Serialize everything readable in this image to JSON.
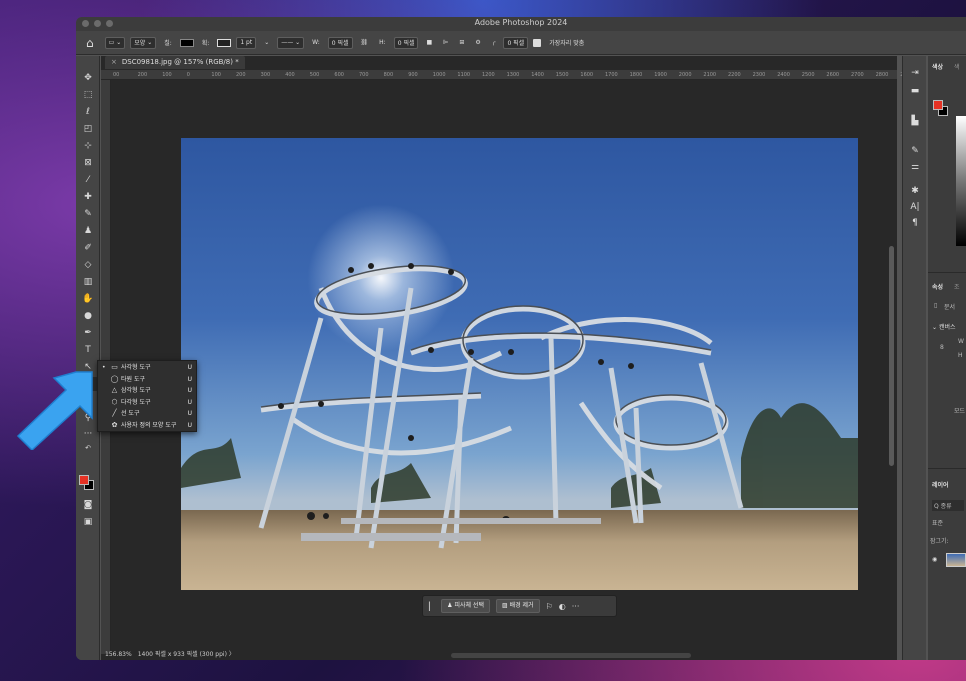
{
  "app_title": "Adobe Photoshop 2024",
  "options_bar": {
    "mode_label": "모양",
    "fill_label": "칠:",
    "stroke_label": "획:",
    "stroke_width": "1 pt",
    "w_label": "W:",
    "w_value": "0 픽셀",
    "h_label": "H:",
    "h_value": "0 픽셀",
    "radius_value": "0 픽셀",
    "align_edges_label": "가장자리 맞춤"
  },
  "document": {
    "tab_title": "DSC09818.jpg @ 157% (RGB/8) *",
    "ruler_ticks": [
      "00",
      "200",
      "100",
      "0",
      "100",
      "200",
      "300",
      "400",
      "500",
      "600",
      "700",
      "800",
      "900",
      "1000",
      "1100",
      "1200",
      "1300",
      "1400",
      "1500",
      "1600",
      "1700",
      "1800",
      "1900",
      "2000",
      "2100",
      "2200",
      "2300",
      "2400",
      "2500",
      "2600",
      "2700",
      "2800",
      "290"
    ]
  },
  "status_bar": {
    "zoom": "156.83%",
    "dimensions": "1400 픽셀 x 933 픽셀 (300 ppi)",
    "chevron": "〉"
  },
  "context_bar": {
    "select_subject": "피사체 선택",
    "remove_background": "배경 제거",
    "more": "···"
  },
  "shape_flyout": {
    "items": [
      {
        "label": "사각형 도구",
        "key": "U",
        "icon": "rectangle-icon",
        "selected": true
      },
      {
        "label": "타원 도구",
        "key": "U",
        "icon": "ellipse-icon",
        "selected": false
      },
      {
        "label": "삼각형 도구",
        "key": "U",
        "icon": "triangle-icon",
        "selected": false
      },
      {
        "label": "다각형 도구",
        "key": "U",
        "icon": "polygon-icon",
        "selected": false
      },
      {
        "label": "선 도구",
        "key": "U",
        "icon": "line-icon",
        "selected": false
      },
      {
        "label": "사용자 정의 모양 도구",
        "key": "U",
        "icon": "custom-shape-icon",
        "selected": false
      }
    ]
  },
  "right_panel": {
    "color_tab": "색상",
    "color_tab2": "색",
    "properties_tab": "속성",
    "properties_tab2": "조",
    "doc_label": "문서",
    "canvas_label": "캔버스",
    "w_label": "W",
    "h_label": "H",
    "mode_label": "모드",
    "layers_tab": "레이어",
    "search_label": "Q 종류",
    "normal_label": "표준",
    "lock_label": "잠그기:"
  },
  "colors": {
    "foreground": "#e53224",
    "background": "#000000",
    "arrow": "#3aa3f0"
  }
}
